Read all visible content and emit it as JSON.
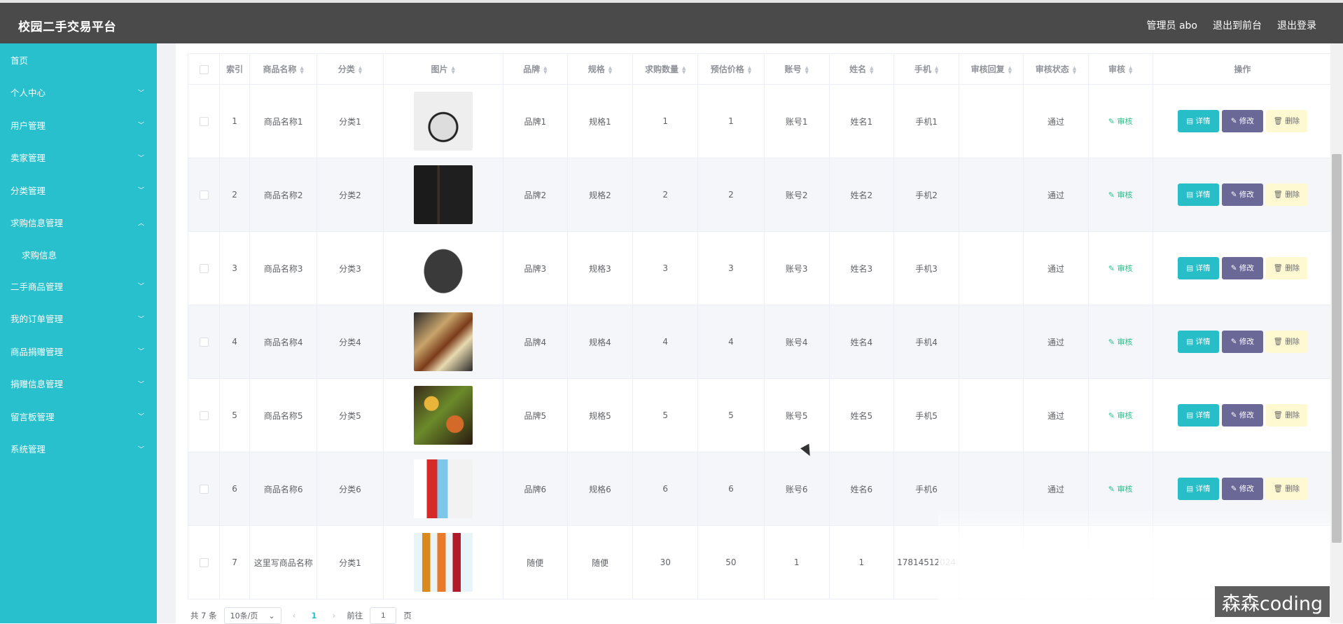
{
  "app": {
    "title": "校园二手交易平台",
    "user_label": "管理员 abo",
    "to_front_label": "退出到前台",
    "logout_label": "退出登录"
  },
  "sidebar": {
    "items": [
      {
        "label": "首页",
        "chevron": false
      },
      {
        "label": "个人中心",
        "chevron": "down"
      },
      {
        "label": "用户管理",
        "chevron": "down"
      },
      {
        "label": "卖家管理",
        "chevron": "down"
      },
      {
        "label": "分类管理",
        "chevron": "down"
      },
      {
        "label": "求购信息管理",
        "chevron": "up"
      },
      {
        "label": "二手商品管理",
        "chevron": "down"
      },
      {
        "label": "我的订单管理",
        "chevron": "down"
      },
      {
        "label": "商品捐赠管理",
        "chevron": "down"
      },
      {
        "label": "捐赠信息管理",
        "chevron": "down"
      },
      {
        "label": "留言板管理",
        "chevron": "down"
      },
      {
        "label": "系统管理",
        "chevron": "down"
      }
    ],
    "sub_item": "求购信息"
  },
  "table": {
    "headers": {
      "index": "索引",
      "name": "商品名称",
      "category": "分类",
      "image": "图片",
      "brand": "品牌",
      "spec": "规格",
      "qty": "求购数量",
      "price": "预估价格",
      "account": "账号",
      "realname": "姓名",
      "phone": "手机",
      "reply": "审核回复",
      "status": "审核状态",
      "audit": "审核",
      "actions": "操作"
    },
    "audit_link": "审核",
    "btn_detail": "详情",
    "btn_edit": "修改",
    "btn_delete": "删除",
    "rows": [
      {
        "index": "1",
        "name": "商品名称1",
        "category": "分类1",
        "image": "book-photo",
        "brand": "品牌1",
        "spec": "规格1",
        "qty": "1",
        "price": "1",
        "account": "账号1",
        "realname": "姓名1",
        "phone": "手机1",
        "reply": "",
        "status": "通过"
      },
      {
        "index": "2",
        "name": "商品名称2",
        "category": "分类2",
        "image": "book-box-photo",
        "brand": "品牌2",
        "spec": "规格2",
        "qty": "2",
        "price": "2",
        "account": "账号2",
        "realname": "姓名2",
        "phone": "手机2",
        "reply": "",
        "status": "通过"
      },
      {
        "index": "3",
        "name": "商品名称3",
        "category": "分类3",
        "image": "bag-photo",
        "brand": "品牌3",
        "spec": "规格3",
        "qty": "3",
        "price": "3",
        "account": "账号3",
        "realname": "姓名3",
        "phone": "手机3",
        "reply": "",
        "status": "通过"
      },
      {
        "index": "4",
        "name": "商品名称4",
        "category": "分类4",
        "image": "bento-photo",
        "brand": "品牌4",
        "spec": "规格4",
        "qty": "4",
        "price": "4",
        "account": "账号4",
        "realname": "姓名4",
        "phone": "手机4",
        "reply": "",
        "status": "通过"
      },
      {
        "index": "5",
        "name": "商品名称5",
        "category": "分类5",
        "image": "food-photo",
        "brand": "品牌5",
        "spec": "规格5",
        "qty": "5",
        "price": "5",
        "account": "账号5",
        "realname": "姓名5",
        "phone": "手机5",
        "reply": "",
        "status": "通过"
      },
      {
        "index": "6",
        "name": "商品名称6",
        "category": "分类6",
        "image": "milk-photo",
        "brand": "品牌6",
        "spec": "规格6",
        "qty": "6",
        "price": "6",
        "account": "账号6",
        "realname": "姓名6",
        "phone": "手机6",
        "reply": "",
        "status": "通过"
      },
      {
        "index": "7",
        "name": "这里写商品名称",
        "category": "分类1",
        "image": "bottles-photo",
        "brand": "随便",
        "spec": "随便",
        "qty": "30",
        "price": "50",
        "account": "1",
        "realname": "1",
        "phone": "17814512024",
        "reply": "",
        "status": ""
      }
    ]
  },
  "pager": {
    "total": "共 7 条",
    "page_size": "10条/页",
    "current": "1",
    "goto_prefix": "前往",
    "goto_value": "1",
    "goto_suffix": "页"
  },
  "watermark": "森森coding",
  "colors": {
    "topbar": "#4a4a4a",
    "sidebar": "#27c0cc",
    "detail_button": "#27bec8",
    "edit_button": "#6a6897",
    "delete_button": "#fef9d0",
    "audit_link": "#27c08a"
  }
}
